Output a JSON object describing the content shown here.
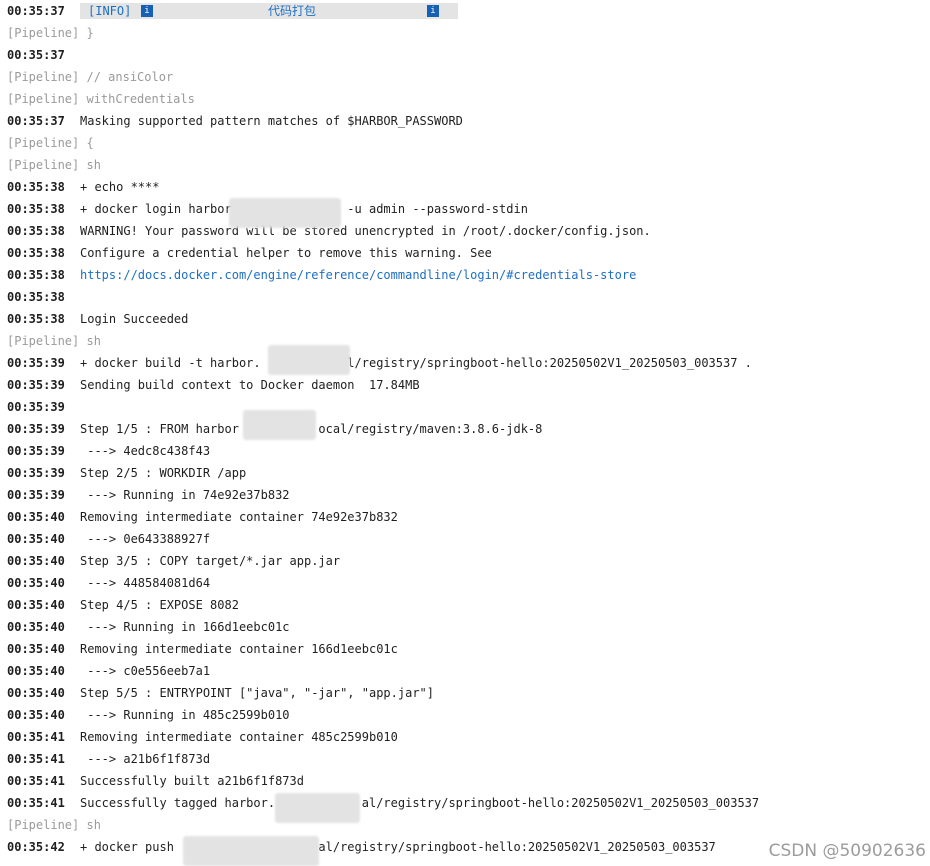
{
  "info_bar": {
    "tag": "[INFO]",
    "icon": "i",
    "title": "代码打包"
  },
  "lines": [
    {
      "ts": "00:35:37",
      "info": true
    },
    {
      "pipe": "[Pipeline] }"
    },
    {
      "ts": "00:35:37",
      "msg": ""
    },
    {
      "pipe": "[Pipeline] // ansiColor"
    },
    {
      "pipe": "[Pipeline] withCredentials"
    },
    {
      "ts": "00:35:37",
      "msg": "Masking supported pattern matches of $HARBOR_PASSWORD"
    },
    {
      "pipe": "[Pipeline] {"
    },
    {
      "pipe": "[Pipeline] sh"
    },
    {
      "ts": "00:35:38",
      "msg": "+ echo ****"
    },
    {
      "ts": "00:35:38",
      "msg": "+ docker login harbor                -u admin --password-stdin"
    },
    {
      "ts": "00:35:38",
      "msg": "WARNING! Your password will be stored unencrypted in /root/.docker/config.json."
    },
    {
      "ts": "00:35:38",
      "msg": "Configure a credential helper to remove this warning. See"
    },
    {
      "ts": "00:35:38",
      "msg": "https://docs.docker.com/engine/reference/commandline/login/#credentials-store",
      "link": true
    },
    {
      "ts": "00:35:38",
      "msg": ""
    },
    {
      "ts": "00:35:38",
      "msg": "Login Succeeded"
    },
    {
      "pipe": "[Pipeline] sh"
    },
    {
      "ts": "00:35:39",
      "msg": "+ docker build -t harbor.            l/registry/springboot-hello:20250502V1_20250503_003537 ."
    },
    {
      "ts": "00:35:39",
      "msg": "Sending build context to Docker daemon  17.84MB"
    },
    {
      "ts": "00:35:39",
      "msg": ""
    },
    {
      "ts": "00:35:39",
      "msg": "Step 1/5 : FROM harbor           ocal/registry/maven:3.8.6-jdk-8"
    },
    {
      "ts": "00:35:39",
      "msg": " ---> 4edc8c438f43"
    },
    {
      "ts": "00:35:39",
      "msg": "Step 2/5 : WORKDIR /app"
    },
    {
      "ts": "00:35:39",
      "msg": " ---> Running in 74e92e37b832"
    },
    {
      "ts": "00:35:40",
      "msg": "Removing intermediate container 74e92e37b832"
    },
    {
      "ts": "00:35:40",
      "msg": " ---> 0e643388927f"
    },
    {
      "ts": "00:35:40",
      "msg": "Step 3/5 : COPY target/*.jar app.jar"
    },
    {
      "ts": "00:35:40",
      "msg": " ---> 448584081d64"
    },
    {
      "ts": "00:35:40",
      "msg": "Step 4/5 : EXPOSE 8082"
    },
    {
      "ts": "00:35:40",
      "msg": " ---> Running in 166d1eebc01c"
    },
    {
      "ts": "00:35:40",
      "msg": "Removing intermediate container 166d1eebc01c"
    },
    {
      "ts": "00:35:40",
      "msg": " ---> c0e556eeb7a1"
    },
    {
      "ts": "00:35:40",
      "msg": "Step 5/5 : ENTRYPOINT [\"java\", \"-jar\", \"app.jar\"]"
    },
    {
      "ts": "00:35:40",
      "msg": " ---> Running in 485c2599b010"
    },
    {
      "ts": "00:35:41",
      "msg": "Removing intermediate container 485c2599b010"
    },
    {
      "ts": "00:35:41",
      "msg": " ---> a21b6f1f873d"
    },
    {
      "ts": "00:35:41",
      "msg": "Successfully built a21b6f1f873d"
    },
    {
      "ts": "00:35:41",
      "msg": "Successfully tagged harbor.            al/registry/springboot-hello:20250502V1_20250503_003537"
    },
    {
      "pipe": "[Pipeline] sh"
    },
    {
      "ts": "00:35:42",
      "msg": "+ docker push                    al/registry/springboot-hello:20250502V1_20250503_003537"
    }
  ],
  "watermark": "CSDN @50902636",
  "colors": {
    "link": "#1d6fc3",
    "pipeline": "#9a9a9a",
    "info_icon": "#1660b5"
  }
}
